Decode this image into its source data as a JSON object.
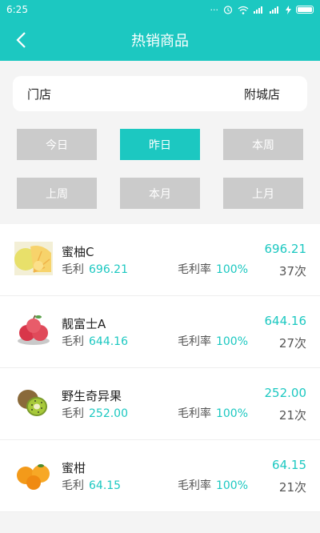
{
  "status_bar": {
    "time": "6:25",
    "icons": "··· ⏰ 📶 ▮▮ ⚡"
  },
  "header": {
    "title": "热销商品"
  },
  "store": {
    "label": "门店",
    "value": "附城店"
  },
  "periods": [
    {
      "label": "今日",
      "active": false
    },
    {
      "label": "昨日",
      "active": true
    },
    {
      "label": "本周",
      "active": false
    },
    {
      "label": "上周",
      "active": false
    },
    {
      "label": "本月",
      "active": false
    },
    {
      "label": "上月",
      "active": false
    }
  ],
  "labels": {
    "profit": "毛利",
    "rate": "毛利率"
  },
  "products": [
    {
      "name": "蜜柚C",
      "profit": "696.21",
      "rate": "100%",
      "amount": "696.21",
      "count": "37次",
      "icon": "pomelo-icon"
    },
    {
      "name": "靓富士A",
      "profit": "644.16",
      "rate": "100%",
      "amount": "644.16",
      "count": "27次",
      "icon": "apple-icon"
    },
    {
      "name": "野生奇异果",
      "profit": "252.00",
      "rate": "100%",
      "amount": "252.00",
      "count": "21次",
      "icon": "kiwi-icon"
    },
    {
      "name": "蜜柑",
      "profit": "64.15",
      "rate": "100%",
      "amount": "64.15",
      "count": "21次",
      "icon": "mandarin-icon"
    }
  ],
  "colors": {
    "accent": "#1cc8c1",
    "inactive_button": "#cbcbcb"
  }
}
